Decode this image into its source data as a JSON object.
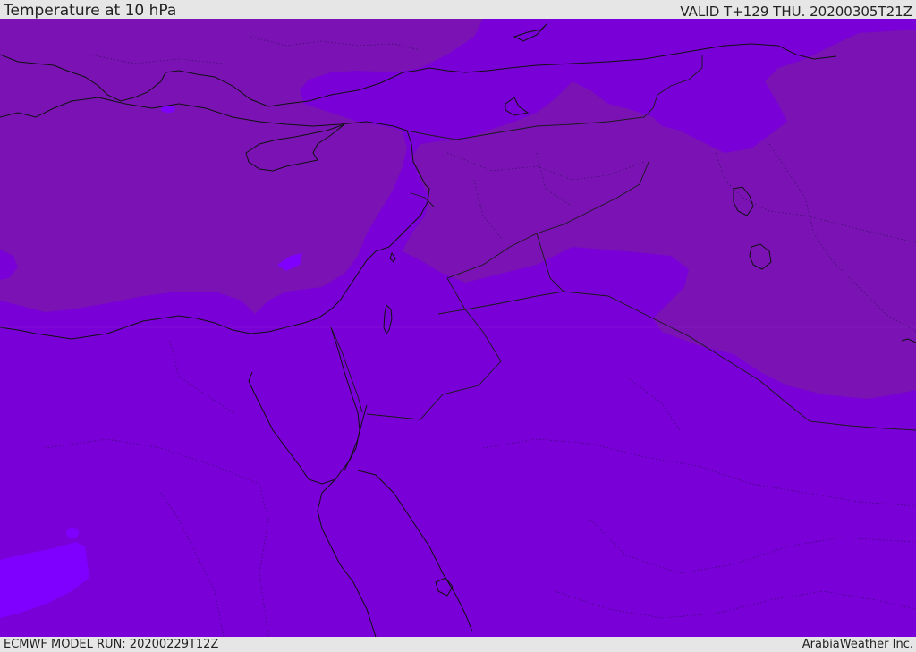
{
  "header": {
    "title": "Temperature at 10 hPa",
    "valid_time": "VALID T+129 THU. 20200305T21Z"
  },
  "footer": {
    "model_run": "ECMWF MODEL RUN: 20200229T12Z",
    "provider": "ArabiaWeather Inc."
  },
  "map": {
    "colors": {
      "base_band": "#7a00d8",
      "warm_band": "#7a12b4",
      "cool_band": "#8000ff",
      "coastline": "#111111",
      "border": "#1a1a1a"
    }
  }
}
